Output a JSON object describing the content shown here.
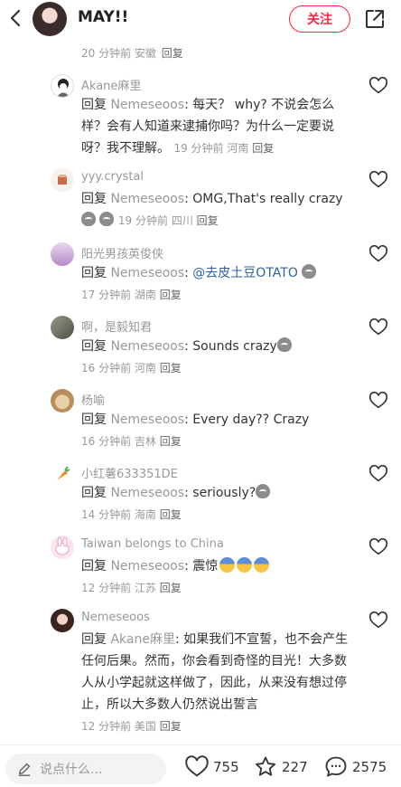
{
  "header": {
    "title": "MAY!!",
    "follow_label": "关注"
  },
  "parent_meta": {
    "time": "20 分钟前",
    "location": "安徽",
    "reply_label": "回复"
  },
  "comments": [
    {
      "name": "Akane麻里",
      "reply_word": "回复",
      "target": "Nemeseoos",
      "text": ": 每天？ why? 不说会怎么样？会有人知道来逮捕你吗？为什么一定要说呀？我不理解。",
      "time": "19 分钟前",
      "location": "河南",
      "reply_label": "回复"
    },
    {
      "name": "yyy.crystal",
      "reply_word": "回复",
      "target": "Nemeseoos",
      "text": ": OMG,That's really crazy",
      "time": "19 分钟前",
      "location": "四川",
      "reply_label": "回复"
    },
    {
      "name": "阳光男孩英俊侠",
      "reply_word": "回复",
      "target": "Nemeseoos",
      "text": ": ",
      "mention": "@去皮土豆OTATO",
      "time": "17 分钟前",
      "location": "湖南",
      "reply_label": "回复"
    },
    {
      "name": "啊，是毅知君",
      "reply_word": "回复",
      "target": "Nemeseoos",
      "text": ": Sounds crazy",
      "time": "16 分钟前",
      "location": "河南",
      "reply_label": "回复"
    },
    {
      "name": "杨喻",
      "reply_word": "回复",
      "target": "Nemeseoos",
      "text": ": Every day?? Crazy",
      "time": "16 分钟前",
      "location": "吉林",
      "reply_label": "回复"
    },
    {
      "name": "小红薯633351DE",
      "reply_word": "回复",
      "target": "Nemeseoos",
      "text": ": seriously?",
      "time": "14 分钟前",
      "location": "海南",
      "reply_label": "回复"
    },
    {
      "name": "Taiwan belongs to China",
      "reply_word": "回复",
      "target": "Nemeseoos",
      "text": ": 震惊",
      "time": "12 分钟前",
      "location": "江苏",
      "reply_label": "回复"
    },
    {
      "name": "Nemeseoos",
      "reply_word": "回复",
      "target": "Akane麻里",
      "text": ": 如果我们不宣誓，也不会产生任何后果。然而，你会看到奇怪的目光！大多数人从小学起就这样做了，因此，从来没有想过停止，所以大多数人仍然说出誓言",
      "time": "12 分钟前",
      "location": "美国",
      "reply_label": "回复"
    }
  ],
  "bottom": {
    "input_placeholder": "说点什么...",
    "likes": "755",
    "stars": "227",
    "comments": "2575"
  },
  "colors": {
    "accent": "#ff2442",
    "mention": "#2f5fa7",
    "muted": "#999999"
  }
}
